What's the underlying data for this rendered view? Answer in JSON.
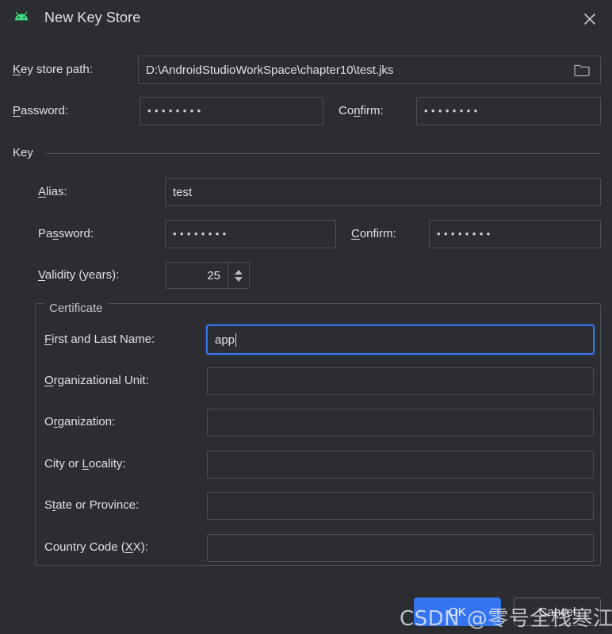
{
  "window": {
    "title": "New Key Store",
    "app_icon": "android-robot-icon",
    "close_icon": "close-icon"
  },
  "keystore": {
    "path_label": "Key store path:",
    "path_label_mnemonic": "K",
    "path_value": "D:\\AndroidStudioWorkSpace\\chapter10\\test.jks",
    "browse_icon": "folder-icon",
    "password_label": "Password:",
    "password_label_mnemonic": "P",
    "password_value": "••••••••",
    "confirm_label_pre": "Co",
    "confirm_label_mnemonic": "n",
    "confirm_label_post": "firm:",
    "confirm_value": "••••••••"
  },
  "key_group": {
    "title": "Key",
    "alias_label": "Alias:",
    "alias_label_mnemonic": "A",
    "alias_value": "test",
    "password_label_pre": "Pa",
    "password_label_mnemonic": "s",
    "password_label_post": "sword:",
    "password_value": "••••••••",
    "confirm_label_mnemonic": "C",
    "confirm_label_post": "onfirm:",
    "confirm_value": "••••••••",
    "validity_label_mnemonic": "V",
    "validity_label_post": "alidity (years):",
    "validity_value": "25"
  },
  "certificate": {
    "legend": "Certificate",
    "fields": [
      {
        "label_mnemonic": "F",
        "label_post": "irst and Last Name:",
        "value": "app",
        "focused": true,
        "name": "first-and-last-name"
      },
      {
        "label_mnemonic": "O",
        "label_post": "rganizational Unit:",
        "value": "",
        "focused": false,
        "name": "organizational-unit"
      },
      {
        "label_pre": "O",
        "label_mnemonic": "r",
        "label_post": "ganization:",
        "value": "",
        "focused": false,
        "name": "organization"
      },
      {
        "label_pre": "City or ",
        "label_mnemonic": "L",
        "label_post": "ocality:",
        "value": "",
        "focused": false,
        "name": "city-or-locality"
      },
      {
        "label_pre": "S",
        "label_mnemonic": "t",
        "label_post": "ate or Province:",
        "value": "",
        "focused": false,
        "name": "state-or-province"
      },
      {
        "label_pre": "Country Code (",
        "label_mnemonic": "X",
        "label_post": "X):",
        "value": "",
        "focused": false,
        "name": "country-code"
      }
    ]
  },
  "buttons": {
    "ok": "OK",
    "cancel": "Cancel"
  },
  "watermark": {
    "text": "CSDN @零号全栈寒江独钓"
  },
  "colors": {
    "background": "#2b2d30",
    "field_border": "#4b4f55",
    "focus_blue": "#3574f0",
    "accent_button": "#3574f0",
    "text": "#dfe1e5",
    "android_green": "#3ddc84"
  }
}
